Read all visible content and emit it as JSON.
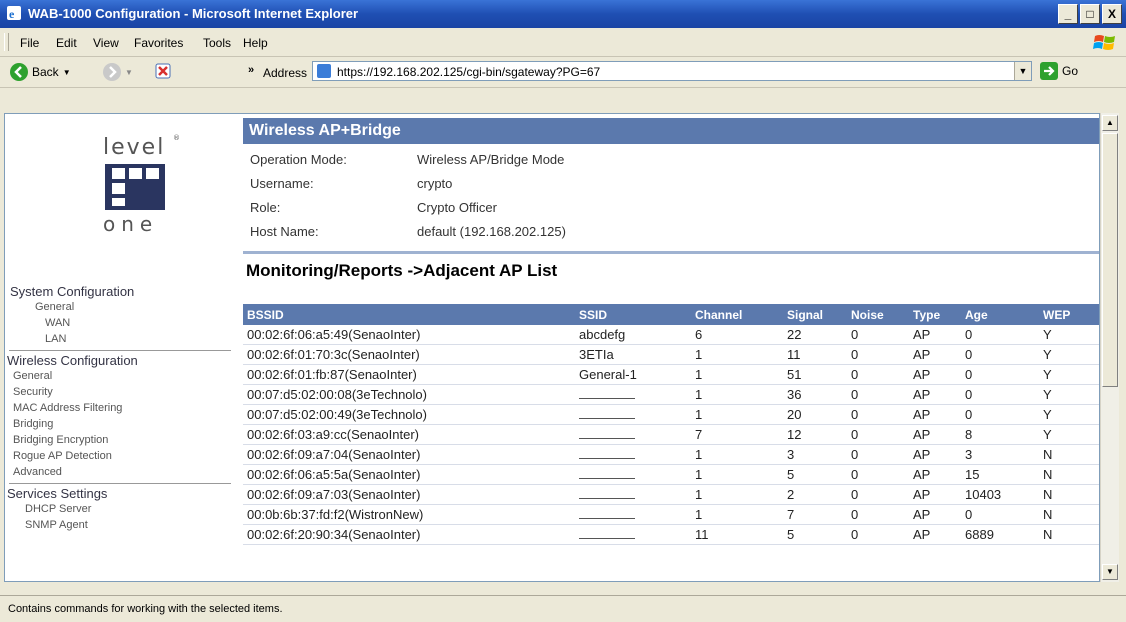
{
  "window": {
    "title": "WAB-1000 Configuration - Microsoft Internet Explorer",
    "controls": [
      "_",
      "□",
      "X"
    ]
  },
  "menu": [
    "File",
    "Edit",
    "View",
    "Favorites",
    "Tools",
    "Help"
  ],
  "toolbar": {
    "back_label": "Back",
    "address_label": "Address",
    "url": "https://192.168.202.125/cgi-bin/sgateway?PG=67",
    "go_label": "Go",
    "chevron": "»"
  },
  "logo": {
    "top_text": "level",
    "bottom_text": "one"
  },
  "nav": {
    "system": {
      "title": "System Configuration",
      "items": [
        "General",
        "WAN",
        "LAN"
      ]
    },
    "wireless": {
      "title": "Wireless Configuration",
      "items": [
        "General",
        "Security",
        "MAC Address Filtering",
        "Bridging",
        "Bridging Encryption",
        "Rogue AP Detection",
        "Advanced"
      ]
    },
    "services": {
      "title": "Services Settings",
      "items": [
        "DHCP Server",
        "SNMP Agent"
      ]
    }
  },
  "header": {
    "title": "Wireless AP+Bridge",
    "fields": [
      {
        "label": "Operation Mode:",
        "value": "Wireless AP/Bridge Mode"
      },
      {
        "label": "Username:",
        "value": "crypto"
      },
      {
        "label": "Role:",
        "value": "Crypto Officer"
      },
      {
        "label": "Host Name:",
        "value": "default (192.168.202.125)"
      }
    ]
  },
  "section_title": "Monitoring/Reports ->Adjacent AP List",
  "table": {
    "columns": [
      "BSSID",
      "SSID",
      "Channel",
      "Signal",
      "Noise",
      "Type",
      "Age",
      "WEP"
    ],
    "rows": [
      [
        "00:02:6f:06:a5:49(SenaoInter)",
        "abcdefg",
        "6",
        "22",
        "0",
        "AP",
        "0",
        "Y"
      ],
      [
        "00:02:6f:01:70:3c(SenaoInter)",
        "3ETIa",
        "1",
        "11",
        "0",
        "AP",
        "0",
        "Y"
      ],
      [
        "00:02:6f:01:fb:87(SenaoInter)",
        "General-1",
        "1",
        "51",
        "0",
        "AP",
        "0",
        "Y"
      ],
      [
        "00:07:d5:02:00:08(3eTechnolo)",
        "",
        "1",
        "36",
        "0",
        "AP",
        "0",
        "Y"
      ],
      [
        "00:07:d5:02:00:49(3eTechnolo)",
        "",
        "1",
        "20",
        "0",
        "AP",
        "0",
        "Y"
      ],
      [
        "00:02:6f:03:a9:cc(SenaoInter)",
        "",
        "7",
        "12",
        "0",
        "AP",
        "8",
        "Y"
      ],
      [
        "00:02:6f:09:a7:04(SenaoInter)",
        "",
        "1",
        "3",
        "0",
        "AP",
        "3",
        "N"
      ],
      [
        "00:02:6f:06:a5:5a(SenaoInter)",
        "",
        "1",
        "5",
        "0",
        "AP",
        "15",
        "N"
      ],
      [
        "00:02:6f:09:a7:03(SenaoInter)",
        "",
        "1",
        "2",
        "0",
        "AP",
        "10403",
        "N"
      ],
      [
        "00:0b:6b:37:fd:f2(WistronNew)",
        "",
        "1",
        "7",
        "0",
        "AP",
        "0",
        "N"
      ],
      [
        "00:02:6f:20:90:34(SenaoInter)",
        "",
        "11",
        "5",
        "0",
        "AP",
        "6889",
        "N"
      ]
    ]
  },
  "status": "Contains commands for working with the selected items."
}
